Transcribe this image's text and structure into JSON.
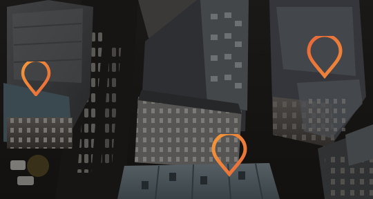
{
  "map": {
    "style": "dark aerial city photo",
    "overlay_tint": "#000000",
    "pin_color": "#e8683a",
    "pin_highlight": "#f39a3a",
    "pins": [
      {
        "id": "pin-west",
        "icon": "map-pin-icon"
      },
      {
        "id": "pin-northeast",
        "icon": "map-pin-icon"
      },
      {
        "id": "pin-south",
        "icon": "map-pin-icon"
      }
    ]
  }
}
